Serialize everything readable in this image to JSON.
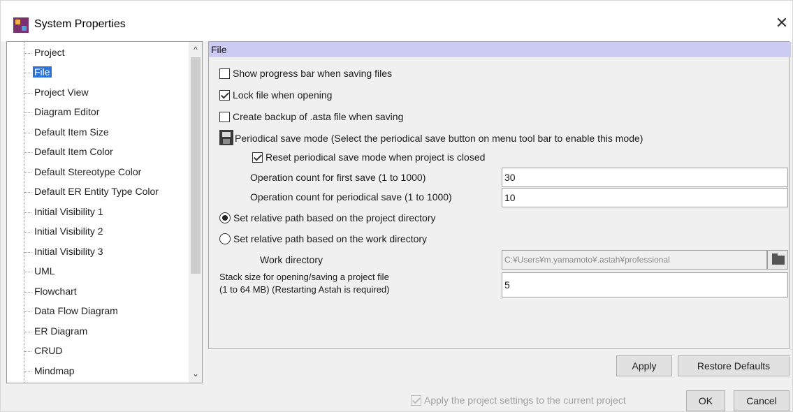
{
  "window": {
    "title": "System Properties",
    "close_glyph": "✕"
  },
  "tree": {
    "items": [
      {
        "label": "Project"
      },
      {
        "label": "File",
        "selected": true
      },
      {
        "label": "Project View"
      },
      {
        "label": "Diagram Editor"
      },
      {
        "label": "Default Item Size"
      },
      {
        "label": "Default Item Color"
      },
      {
        "label": "Default Stereotype Color"
      },
      {
        "label": "Default ER Entity Type Color"
      },
      {
        "label": "Initial Visibility 1"
      },
      {
        "label": "Initial Visibility 2"
      },
      {
        "label": "Initial Visibility 3"
      },
      {
        "label": "UML"
      },
      {
        "label": "Flowchart"
      },
      {
        "label": "Data Flow Diagram"
      },
      {
        "label": "ER Diagram"
      },
      {
        "label": "CRUD"
      },
      {
        "label": "Mindmap"
      }
    ],
    "scroll_up_glyph": "^",
    "scroll_down_glyph": "⌄"
  },
  "content": {
    "section_title": "File",
    "show_progress_bar": {
      "label": "Show progress bar when saving files",
      "checked": false
    },
    "lock_file": {
      "label": "Lock file when opening",
      "checked": true
    },
    "create_backup": {
      "label": "Create backup of .asta file when saving",
      "checked": false
    },
    "periodical_save": {
      "label": "Periodical save mode  (Select the periodical save button on menu tool bar to enable this mode)"
    },
    "reset_periodical": {
      "label": "Reset periodical save mode when project is closed",
      "checked": true
    },
    "first_save": {
      "label": "Operation count for first save (1 to 1000)",
      "value": "30"
    },
    "periodical_count": {
      "label": "Operation count for periodical save (1 to 1000)",
      "value": "10"
    },
    "relative_project": {
      "label": "Set relative path based on the project directory",
      "checked": true
    },
    "relative_work": {
      "label": "Set relative path based on the work directory",
      "checked": false
    },
    "work_directory": {
      "label": "Work directory",
      "value": "C:¥Users¥m.yamamoto¥.astah¥professional"
    },
    "stack_size": {
      "label_line1": "Stack size for opening/saving a project file",
      "label_line2": "(1 to 64 MB) (Restarting Astah is required)",
      "value": "5"
    }
  },
  "buttons": {
    "apply": "Apply",
    "restore_defaults": "Restore Defaults",
    "ok": "OK",
    "cancel": "Cancel"
  },
  "footer": {
    "apply_project_settings": {
      "label": "Apply the project settings to the current project",
      "checked": true,
      "disabled": true
    }
  },
  "icons": {
    "app": "astah-app-icon",
    "close": "close-icon",
    "periodical_save": "periodical-save-icon",
    "folder": "folder-open-icon"
  },
  "colors": {
    "section_header": "#ccccf2",
    "selection": "#2b72d9"
  }
}
